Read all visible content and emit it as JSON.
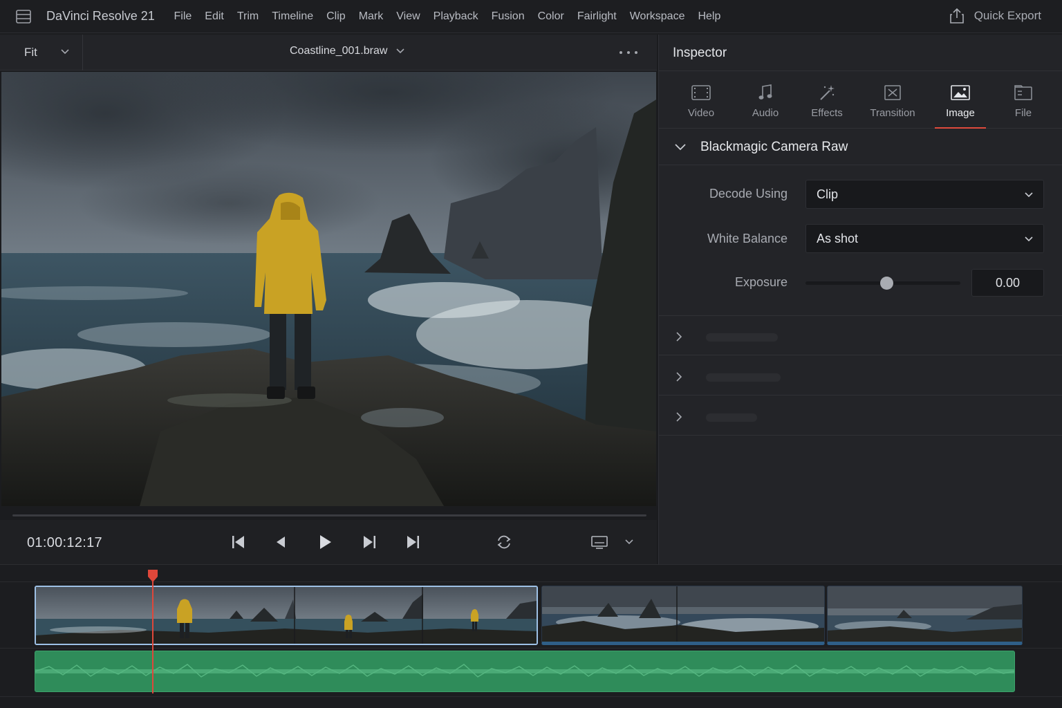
{
  "app": {
    "title": "DaVinci Resolve 21"
  },
  "menu": [
    "File",
    "Edit",
    "Trim",
    "Timeline",
    "Clip",
    "Mark",
    "View",
    "Playback",
    "Fusion",
    "Color",
    "Fairlight",
    "Workspace",
    "Help"
  ],
  "toolbar": {
    "quick_export_label": "Quick Export"
  },
  "viewer": {
    "zoom": "Fit",
    "clip_name": "Coastline_001.braw",
    "timecode": "01:00:12:17"
  },
  "inspector": {
    "title": "Inspector",
    "tabs": [
      {
        "label": "Video",
        "icon": "film-icon"
      },
      {
        "label": "Audio",
        "icon": "music-note-icon"
      },
      {
        "label": "Effects",
        "icon": "magic-wand-icon"
      },
      {
        "label": "Transition",
        "icon": "transition-icon"
      },
      {
        "label": "Image",
        "icon": "image-icon",
        "active": true
      },
      {
        "label": "File",
        "icon": "file-icon"
      }
    ],
    "section": {
      "title": "Blackmagic Camera Raw",
      "decode_label": "Decode Using",
      "decode_value": "Clip",
      "wb_label": "White Balance",
      "wb_value": "As shot",
      "exposure_label": "Exposure",
      "exposure_value": "0.00",
      "exposure_slider_fraction": 0.5
    }
  },
  "colors": {
    "accent": "#e04a3c",
    "selection": "#9ec1e6",
    "audio": "#2f8c5a"
  }
}
